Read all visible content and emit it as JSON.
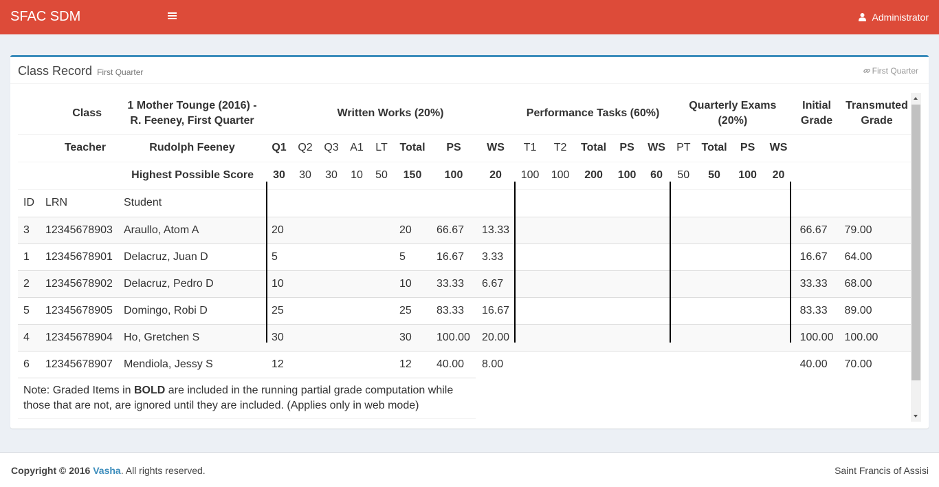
{
  "header": {
    "brand": "SFAC SDM",
    "user_name": "Administrator",
    "menu_icon": "bars-icon",
    "user_icon": "user-icon",
    "color": "#dd4b39"
  },
  "box": {
    "title": "Class Record",
    "subtitle": "First Quarter",
    "link_label": "First Quarter",
    "link_icon": "link-icon",
    "accent": "#3c8dbc"
  },
  "table": {
    "row1": {
      "class_label": "Class",
      "class_value_line1": "1 Mother Tounge (2016) -",
      "class_value_line2": "R. Feeney, First Quarter",
      "ww": "Written Works (20%)",
      "pt": "Performance Tasks (60%)",
      "qe_line1": "Quarterly Exams",
      "qe_line2": "(20%)",
      "initial_line1": "Initial",
      "initial_line2": "Grade",
      "trans_line1": "Transmuted",
      "trans_line2": "Grade"
    },
    "row2": {
      "teacher_label": "Teacher",
      "teacher_value": "Rudolph Feeney",
      "cols": [
        "Q1",
        "Q2",
        "Q3",
        "A1",
        "LT",
        "Total",
        "PS",
        "WS",
        "T1",
        "T2",
        "Total",
        "PS",
        "WS",
        "PT",
        "Total",
        "PS",
        "WS"
      ]
    },
    "row3": {
      "label": "Highest Possible Score",
      "cols": [
        "30",
        "30",
        "30",
        "10",
        "50",
        "150",
        "100",
        "20",
        "100",
        "100",
        "200",
        "100",
        "60",
        "50",
        "50",
        "100",
        "20"
      ]
    },
    "row4": {
      "id": "ID",
      "lrn": "LRN",
      "student": "Student"
    },
    "students": [
      {
        "id": "3",
        "lrn": "12345678903",
        "name": "Araullo, Atom A",
        "q1": "20",
        "total": "20",
        "ps": "66.67",
        "ws": "13.33",
        "initial": "66.67",
        "transmuted": "79.00"
      },
      {
        "id": "1",
        "lrn": "12345678901",
        "name": "Delacruz, Juan D",
        "q1": "5",
        "total": "5",
        "ps": "16.67",
        "ws": "3.33",
        "initial": "16.67",
        "transmuted": "64.00"
      },
      {
        "id": "2",
        "lrn": "12345678902",
        "name": "Delacruz, Pedro D",
        "q1": "10",
        "total": "10",
        "ps": "33.33",
        "ws": "6.67",
        "initial": "33.33",
        "transmuted": "68.00"
      },
      {
        "id": "5",
        "lrn": "12345678905",
        "name": "Domingo, Robi D",
        "q1": "25",
        "total": "25",
        "ps": "83.33",
        "ws": "16.67",
        "initial": "83.33",
        "transmuted": "89.00"
      },
      {
        "id": "4",
        "lrn": "12345678904",
        "name": "Ho, Gretchen S",
        "q1": "30",
        "total": "30",
        "ps": "100.00",
        "ws": "20.00",
        "initial": "100.00",
        "transmuted": "100.00"
      },
      {
        "id": "6",
        "lrn": "12345678907",
        "name": "Mendiola, Jessy S",
        "q1": "12",
        "total": "12",
        "ps": "40.00",
        "ws": "8.00",
        "initial": "40.00",
        "transmuted": "70.00"
      }
    ],
    "note_prefix": "Note: Graded Items in ",
    "note_bold": "BOLD",
    "note_suffix": " are included in the running partial grade computation while those that are not, are ignored until they are included. (Applies only in web mode)"
  },
  "footer": {
    "copyright_prefix": "Copyright © 2016 ",
    "company": "Vasha",
    "rights": ". All rights reserved.",
    "school": "Saint Francis of Assisi"
  }
}
